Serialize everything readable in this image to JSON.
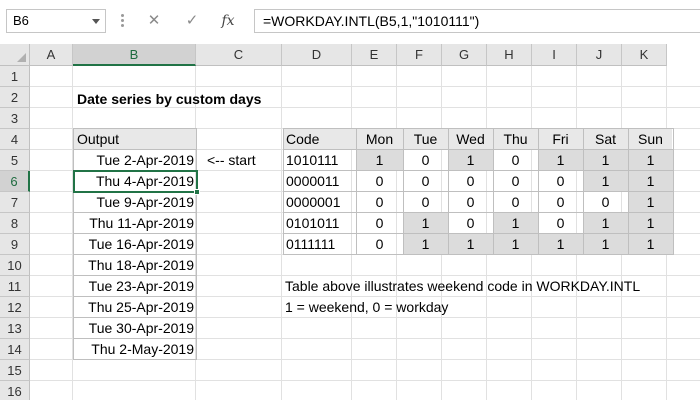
{
  "formula_bar": {
    "name_box": "B6",
    "cancel_icon": "✕",
    "enter_icon": "✓",
    "fx_icon": "fx",
    "formula": "=WORKDAY.INTL(B5,1,\"1010111\")"
  },
  "columns": [
    "A",
    "B",
    "C",
    "D",
    "E",
    "F",
    "G",
    "H",
    "I",
    "J",
    "K"
  ],
  "rows": [
    "1",
    "2",
    "3",
    "4",
    "5",
    "6",
    "7",
    "8",
    "9",
    "10",
    "11",
    "12",
    "13",
    "14",
    "15",
    "16"
  ],
  "selected_column": "B",
  "selected_row": "6",
  "title": "Date series by custom days",
  "output": {
    "header": "Output",
    "dates": [
      "Tue 2-Apr-2019",
      "Thu 4-Apr-2019",
      "Tue 9-Apr-2019",
      "Thu 11-Apr-2019",
      "Tue 16-Apr-2019",
      "Thu 18-Apr-2019",
      "Tue 23-Apr-2019",
      "Thu 25-Apr-2019",
      "Tue 30-Apr-2019",
      "Thu 2-May-2019"
    ]
  },
  "start_label": "<-- start",
  "code_table": {
    "headers": [
      "Code",
      "Mon",
      "Tue",
      "Wed",
      "Thu",
      "Fri",
      "Sat",
      "Sun"
    ],
    "rows": [
      {
        "code": "1010111",
        "values": [
          "1",
          "0",
          "1",
          "0",
          "1",
          "1",
          "1"
        ]
      },
      {
        "code": "0000011",
        "values": [
          "0",
          "0",
          "0",
          "0",
          "0",
          "1",
          "1"
        ]
      },
      {
        "code": "0000001",
        "values": [
          "0",
          "0",
          "0",
          "0",
          "0",
          "0",
          "1"
        ]
      },
      {
        "code": "0101011",
        "values": [
          "0",
          "1",
          "0",
          "1",
          "0",
          "1",
          "1"
        ]
      },
      {
        "code": "0111111",
        "values": [
          "0",
          "1",
          "1",
          "1",
          "1",
          "1",
          "1"
        ]
      }
    ]
  },
  "notes": {
    "line1": "Table above illustrates weekend code in WORKDAY.INTL",
    "line2": "1 = weekend, 0 = workday"
  },
  "colors": {
    "accent": "#217346",
    "weekend_shade": "#dcdcdc",
    "header_fill": "#e8e8e8"
  }
}
